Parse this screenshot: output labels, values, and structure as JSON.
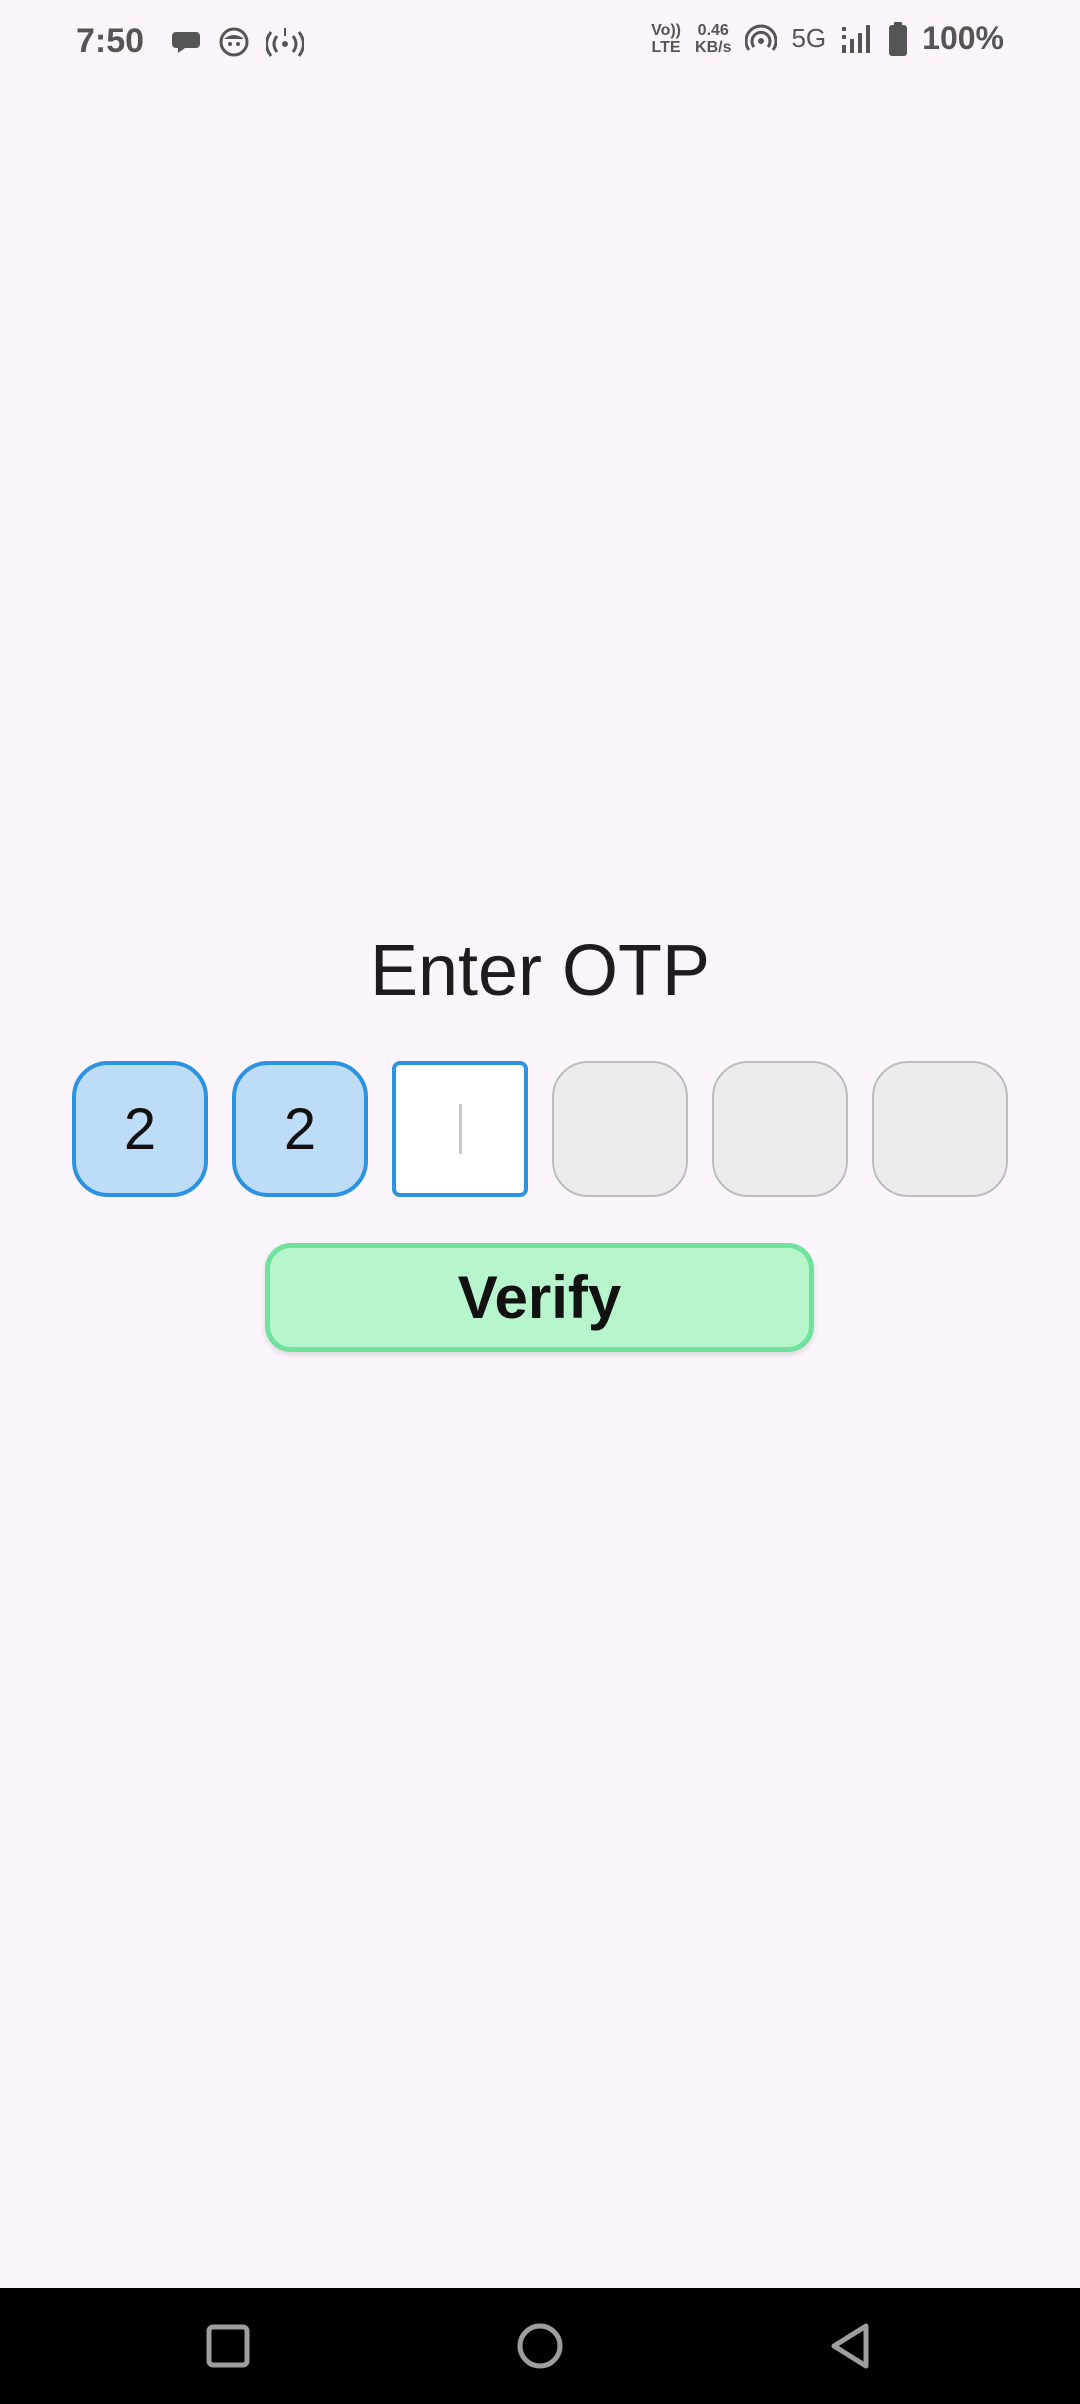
{
  "status_bar": {
    "time": "7:50",
    "volte_top": "Vo))",
    "volte_bottom": "LTE",
    "speed_value": "0.46",
    "speed_unit": "KB/s",
    "network": "5G",
    "battery": "100%",
    "icons": [
      "chat-bubble-icon",
      "face-icon",
      "broadcast-icon",
      "volte-icon",
      "hotspot-icon",
      "signal-icon",
      "battery-icon"
    ]
  },
  "otp": {
    "title": "Enter OTP",
    "digits": [
      "2",
      "2",
      "",
      "",
      "",
      ""
    ],
    "active_index": 2
  },
  "verify": {
    "label": "Verify"
  },
  "nav": {
    "icons": [
      "recents-icon",
      "home-icon",
      "back-icon"
    ]
  },
  "colors": {
    "background": "#fcf5fc",
    "filled_box": "#bcdcf7",
    "accent_blue": "#2c93e2",
    "empty_box": "#ececec",
    "verify_bg": "#b7f5cc",
    "verify_border": "#6fe39e"
  }
}
